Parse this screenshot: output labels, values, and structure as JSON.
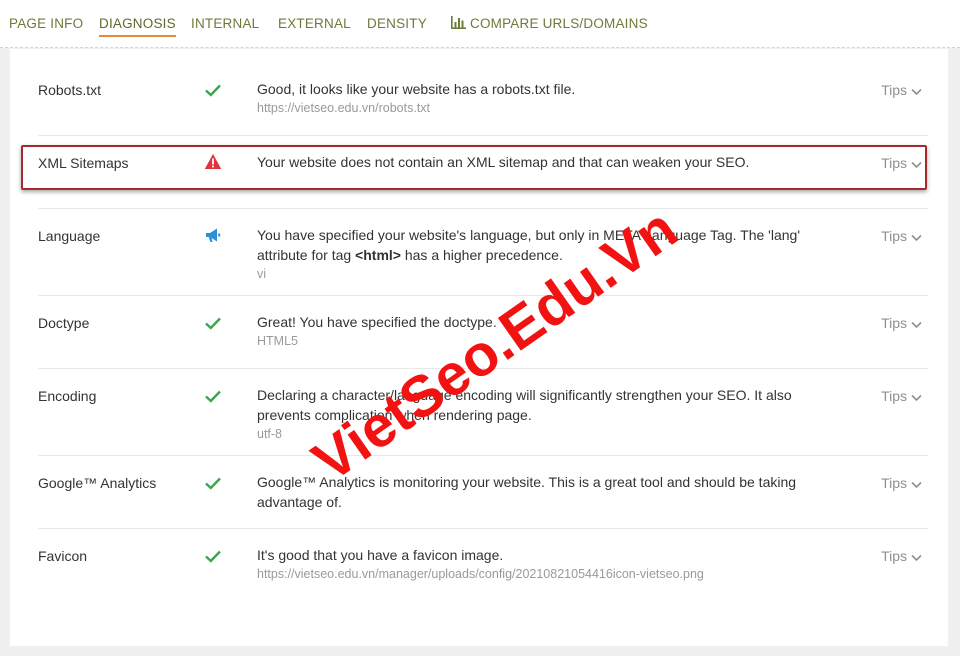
{
  "tabs": [
    {
      "label": "PAGE INFO"
    },
    {
      "label": "DIAGNOSIS",
      "active": true
    },
    {
      "label": "INTERNAL"
    },
    {
      "label": "EXTERNAL"
    },
    {
      "label": "DENSITY"
    },
    {
      "label": "COMPARE URLS/DOMAINS",
      "icon": "bar-chart-icon"
    }
  ],
  "rows": [
    {
      "name": "Robots.txt",
      "status": "check-icon",
      "message": "Good, it looks like your website has a robots.txt file.",
      "sub": "https://vietseo.edu.vn/robots.txt",
      "tips": "Tips"
    },
    {
      "name": "XML Sitemaps",
      "status": "warning-icon",
      "message": "Your website does not contain an XML sitemap and that can weaken your SEO.",
      "sub": "",
      "tips": "Tips"
    },
    {
      "name": "Language",
      "status": "megaphone-icon",
      "message_pre": "You have specified your website's language, but only in META Language Tag. The 'lang' attribute for tag ",
      "message_tag": "<html>",
      "message_post": " has a higher precedence.",
      "sub": "vi",
      "tips": "Tips"
    },
    {
      "name": "Doctype",
      "status": "check-icon",
      "message": "Great! You have specified the doctype.",
      "sub": "HTML5",
      "tips": "Tips"
    },
    {
      "name": "Encoding",
      "status": "check-icon",
      "message": "Declaring a character/language encoding will significantly strengthen your SEO. It also prevents complication when rendering page.",
      "sub": "utf-8",
      "tips": "Tips"
    },
    {
      "name": "Google™ Analytics",
      "status": "check-icon",
      "message": "Google™ Analytics is monitoring your website. This is a great tool and should be taking advantage of.",
      "sub": "",
      "tips": "Tips"
    },
    {
      "name": "Favicon",
      "status": "check-icon",
      "message": "It's good that you have a favicon image.",
      "sub": "https://vietseo.edu.vn/manager/uploads/config/20210821054416icon-vietseo.png",
      "tips": "Tips"
    }
  ],
  "watermark": "VietSeo.Edu.Vn",
  "colors": {
    "check": "#3aa64b",
    "warning": "#e0333a",
    "info": "#2a8fd6",
    "tab_text": "#6b7b3a",
    "tab_underline": "#e58a3a",
    "highlight": "#a8292c"
  }
}
